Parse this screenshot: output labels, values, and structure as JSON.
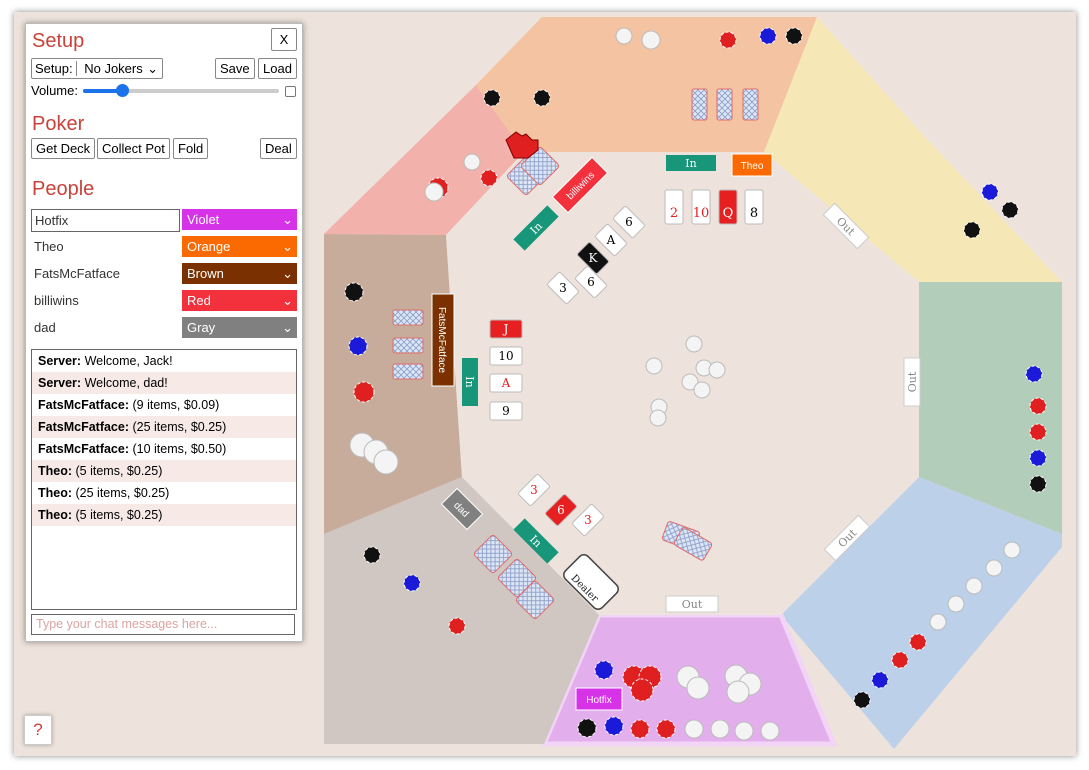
{
  "setup": {
    "title": "Setup",
    "close_label": "X",
    "setup_label": "Setup:",
    "setup_value": "No Jokers",
    "save_label": "Save",
    "load_label": "Load",
    "volume_label": "Volume:",
    "volume_level": 0.2
  },
  "poker": {
    "title": "Poker",
    "buttons": [
      "Get Deck",
      "Collect Pot",
      "Fold",
      "Deal"
    ]
  },
  "people": {
    "title": "People",
    "list": [
      {
        "name": "Hotfix",
        "color_name": "Violet",
        "color": "#d633e8"
      },
      {
        "name": "Theo",
        "color_name": "Orange",
        "color": "#fb6a00"
      },
      {
        "name": "FatsMcFatface",
        "color_name": "Brown",
        "color": "#7b3000"
      },
      {
        "name": "billiwins",
        "color_name": "Red",
        "color": "#f2313d"
      },
      {
        "name": "dad",
        "color_name": "Gray",
        "color": "#808080"
      }
    ]
  },
  "log": [
    {
      "who": "Server:",
      "msg": "Welcome, Jack!"
    },
    {
      "who": "Server:",
      "msg": "Welcome, dad!"
    },
    {
      "who": "FatsMcFatface:",
      "msg": "(9 items, $0.09)"
    },
    {
      "who": "FatsMcFatface:",
      "msg": "(25 items, $0.25)"
    },
    {
      "who": "FatsMcFatface:",
      "msg": "(10 items, $0.50)"
    },
    {
      "who": "Theo:",
      "msg": "(5 items, $0.25)"
    },
    {
      "who": "Theo:",
      "msg": "(25 items, $0.25)"
    },
    {
      "who": "Theo:",
      "msg": "(5 items, $0.25)"
    }
  ],
  "chat_placeholder": "Type your chat messages here...",
  "help_label": "?",
  "table": {
    "seat_labels": [
      "Hotfix",
      "Theo",
      "FatsMcFatface",
      "billiwins",
      "dad"
    ],
    "status_in": "In",
    "status_out": "Out",
    "dealer_label": "Dealer",
    "theo_cards": [
      "2",
      "10",
      "Q",
      "8"
    ],
    "billiwins_cards": [
      "6",
      "A",
      "K",
      "6",
      "3"
    ],
    "fats_cards": [
      "J",
      "10",
      "A",
      "9"
    ],
    "dad_cards": [
      "3",
      "6",
      "3"
    ],
    "colors": {
      "pink_seat": "#f2b1ab",
      "orange_seat": "#f4c3a1",
      "yellow_seat": "#f5e8b6",
      "green_seat": "#b3cdbb",
      "blue_seat": "#bdd0ea",
      "violet_seat": "#e3aeec",
      "gray_seat": "#d0c7c2",
      "brown_seat": "#c8ac9b",
      "felt": "#ede3dc",
      "in_badge": "#17967a"
    }
  }
}
